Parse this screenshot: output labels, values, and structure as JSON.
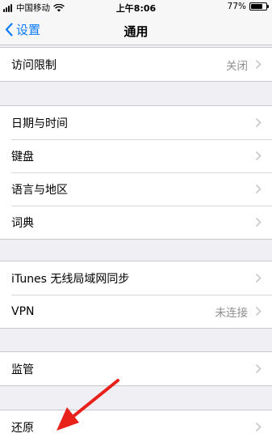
{
  "status_bar": {
    "carrier": "中国移动",
    "time": "上午8:06",
    "battery_text": "77%",
    "battery_level": 0.77
  },
  "nav": {
    "back_label": "设置",
    "title": "通用"
  },
  "groups": [
    [
      {
        "label": "访问限制",
        "value": "关闭"
      }
    ],
    [
      {
        "label": "日期与时间"
      },
      {
        "label": "键盘"
      },
      {
        "label": "语言与地区"
      },
      {
        "label": "词典"
      }
    ],
    [
      {
        "label": "iTunes 无线局域网同步"
      },
      {
        "label": "VPN",
        "value": "未连接"
      }
    ],
    [
      {
        "label": "监管"
      }
    ],
    [
      {
        "label": "还原"
      }
    ]
  ],
  "colors": {
    "accent": "#0a7aff",
    "annotation_arrow": "#e8211b",
    "background": "#efeff4"
  }
}
